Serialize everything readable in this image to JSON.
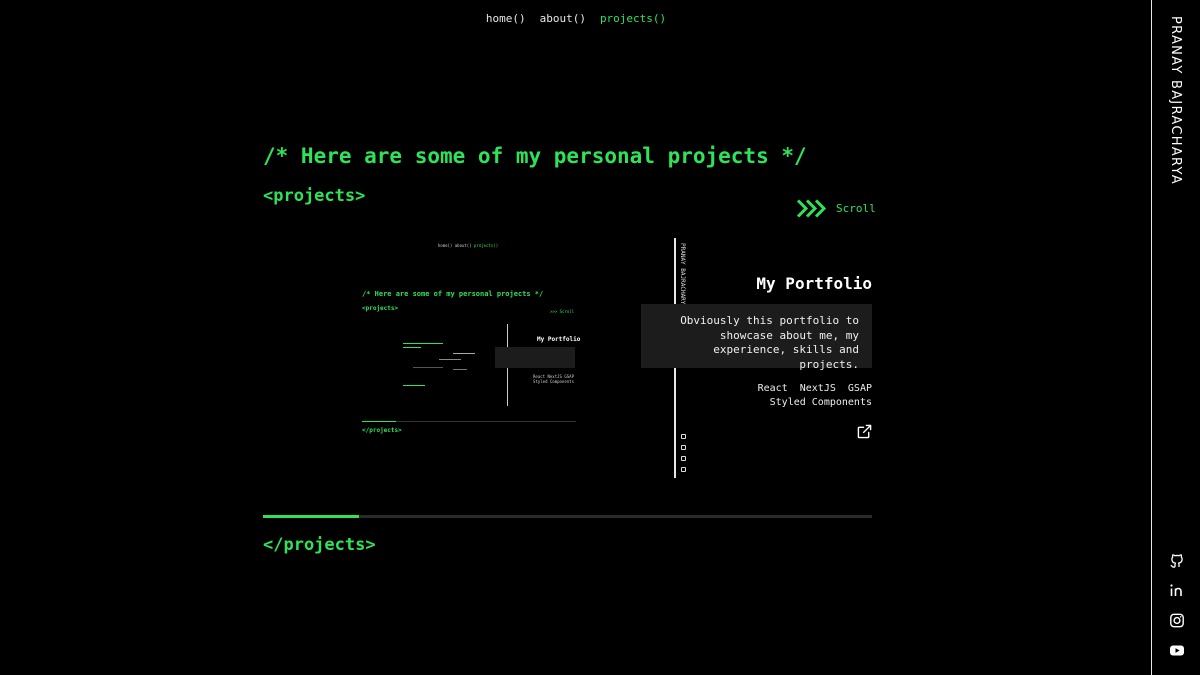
{
  "nav": {
    "home": "home()",
    "about": "about()",
    "projects": "projects()"
  },
  "sidebar": {
    "name": "PRANAY BAJRACHARYA"
  },
  "heading": "/* Here are some of my personal projects */",
  "open_tag": "<projects>",
  "close_tag": "</projects>",
  "scroll_label": "Scroll",
  "project": {
    "title": "My Portfolio",
    "description": "Obviously this portfolio to showcase about me, my experience, skills and projects.",
    "tech": [
      "React",
      "NextJS",
      "GSAP",
      "Styled Components"
    ]
  },
  "carousel_progress": 0.157,
  "colors": {
    "accent": "#2ee25a",
    "background": "#000000",
    "card": "#1c1c1c"
  }
}
